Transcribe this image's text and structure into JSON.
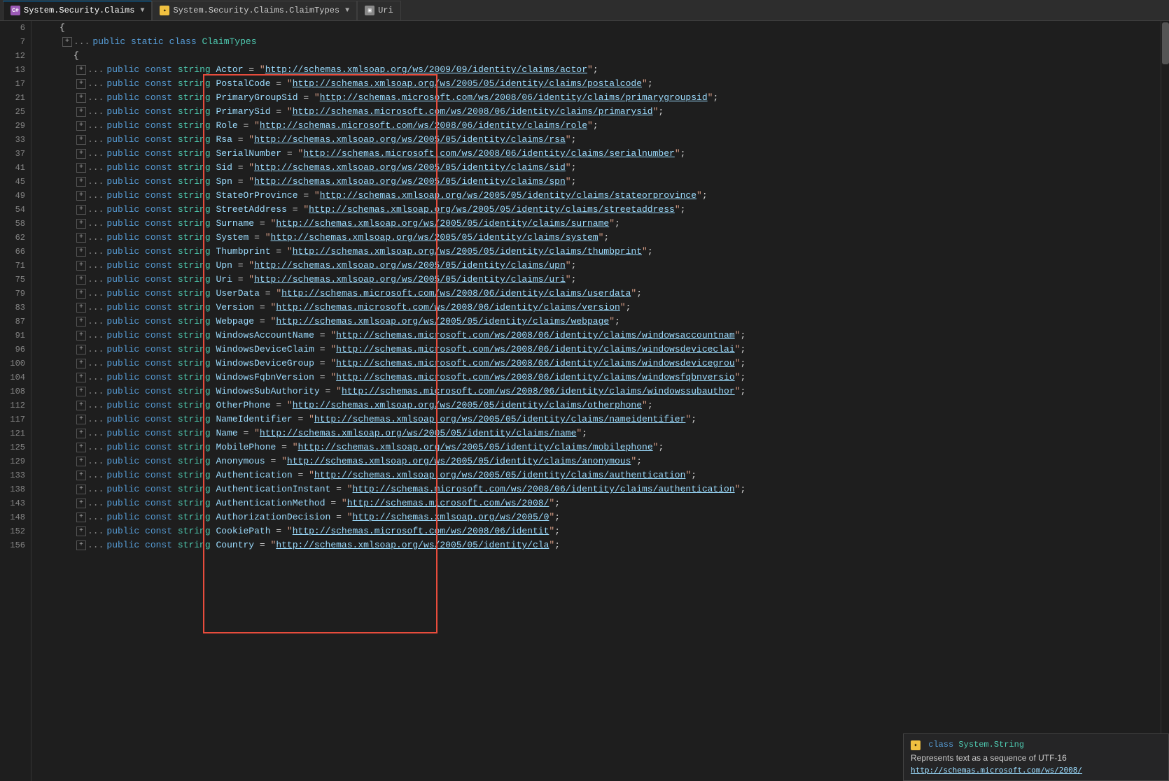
{
  "tabs": [
    {
      "id": "system-security-claims",
      "label": "System.Security.Claims",
      "icon": "cs",
      "active": true,
      "dropdown": true
    },
    {
      "id": "claim-types",
      "label": "System.Security.Claims.ClaimTypes",
      "icon": "cs-yellow",
      "active": false,
      "dropdown": true
    },
    {
      "id": "uri",
      "label": "Uri",
      "icon": "box",
      "active": false,
      "dropdown": false
    }
  ],
  "lines": [
    {
      "num": 6,
      "indent": 1,
      "content": "{"
    },
    {
      "num": 7,
      "indent": 2,
      "content": "public static class ClaimTypes",
      "has_expander": true,
      "has_dots": true
    },
    {
      "num": 12,
      "indent": 2,
      "content": "{",
      "has_expander": false
    },
    {
      "num": 13,
      "indent": 3,
      "content_parts": [
        "public const str",
        "ing Actor = \"",
        "http://schemas.xmlsoap.org/ws/2009/09/identity/claims/actor",
        "\";"
      ],
      "has_expander": true,
      "has_dots": true
    },
    {
      "num": 17,
      "indent": 3,
      "content_parts": [
        "public const str",
        "ing PostalCode = \"",
        "http://schemas.xmlsoap.org/ws/2005/05/identity/claims/postalcode",
        "\";"
      ],
      "has_expander": true,
      "has_dots": true
    },
    {
      "num": 21,
      "indent": 3,
      "content_parts": [
        "public const str",
        "ing PrimaryGroupSid = \"",
        "http://schemas.microsoft.com/ws/2008/06/identity/claims/primarygroupsid",
        "\";"
      ],
      "has_expander": true,
      "has_dots": true
    },
    {
      "num": 25,
      "indent": 3,
      "content_parts": [
        "public const str",
        "ing PrimarySid = \"",
        "http://schemas.microsoft.com/ws/2008/06/identity/claims/primarysid",
        "\";"
      ],
      "has_expander": true,
      "has_dots": true
    },
    {
      "num": 29,
      "indent": 3,
      "content_parts": [
        "public const str",
        "ing Role = \"",
        "http://schemas.microsoft.com/ws/2008/06/identity/claims/role",
        "\";"
      ],
      "has_expander": true,
      "has_dots": true
    },
    {
      "num": 33,
      "indent": 3,
      "content_parts": [
        "public const str",
        "ing Rsa = \"",
        "http://schemas.xmlsoap.org/ws/2005/05/identity/claims/rsa",
        "\";"
      ],
      "has_expander": true,
      "has_dots": true
    },
    {
      "num": 37,
      "indent": 3,
      "content_parts": [
        "public const str",
        "ing SerialNumber = \"",
        "http://schemas.microsoft.com/ws/2008/06/identity/claims/serialnumber",
        "\";"
      ],
      "has_expander": true,
      "has_dots": true
    },
    {
      "num": 41,
      "indent": 3,
      "content_parts": [
        "public const str",
        "ing Sid = \"",
        "http://schemas.xmlsoap.org/ws/2005/05/identity/claims/sid",
        "\";"
      ],
      "has_expander": true,
      "has_dots": true
    },
    {
      "num": 45,
      "indent": 3,
      "content_parts": [
        "public const str",
        "ing Spn = \"",
        "http://schemas.xmlsoap.org/ws/2005/05/identity/claims/spn",
        "\";"
      ],
      "has_expander": true,
      "has_dots": true
    },
    {
      "num": 49,
      "indent": 3,
      "content_parts": [
        "public const str",
        "ing StateOrProvince = \"",
        "http://schemas.xmlsoap.org/ws/2005/05/identity/claims/stateorprovince",
        "\";"
      ],
      "has_expander": true,
      "has_dots": true
    },
    {
      "num": 54,
      "indent": 3,
      "content_parts": [
        "public const str",
        "ing StreetAddress = \"",
        "http://schemas.xmlsoap.org/ws/2005/05/identity/claims/streetaddress",
        "\";"
      ],
      "has_expander": true,
      "has_dots": true
    },
    {
      "num": 58,
      "indent": 3,
      "content_parts": [
        "public const str",
        "ing Surname = \"",
        "http://schemas.xmlsoap.org/ws/2005/05/identity/claims/surname",
        "\";"
      ],
      "has_expander": true,
      "has_dots": true
    },
    {
      "num": 62,
      "indent": 3,
      "content_parts": [
        "public const str",
        "ing System = \"",
        "http://schemas.xmlsoap.org/ws/2005/05/identity/claims/system",
        "\";"
      ],
      "has_expander": true,
      "has_dots": true
    },
    {
      "num": 66,
      "indent": 3,
      "content_parts": [
        "public const str",
        "ing Thumbprint = \"",
        "http://schemas.xmlsoap.org/ws/2005/05/identity/claims/thumbprint",
        "\";"
      ],
      "has_expander": true,
      "has_dots": true
    },
    {
      "num": 71,
      "indent": 3,
      "content_parts": [
        "public const str",
        "ing Upn = \"",
        "http://schemas.xmlsoap.org/ws/2005/05/identity/claims/upn",
        "\";"
      ],
      "has_expander": true,
      "has_dots": true
    },
    {
      "num": 75,
      "indent": 3,
      "content_parts": [
        "public const str",
        "ing Uri = \"",
        "http://schemas.xmlsoap.org/ws/2005/05/identity/claims/uri",
        "\";"
      ],
      "has_expander": true,
      "has_dots": true
    },
    {
      "num": 79,
      "indent": 3,
      "content_parts": [
        "public const str",
        "ing UserData = \"",
        "http://schemas.microsoft.com/ws/2008/06/identity/claims/userdata",
        "\";"
      ],
      "has_expander": true,
      "has_dots": true
    },
    {
      "num": 83,
      "indent": 3,
      "content_parts": [
        "public const str",
        "ing Version = \"",
        "http://schemas.microsoft.com/ws/2008/06/identity/claims/version",
        "\";"
      ],
      "has_expander": true,
      "has_dots": true
    },
    {
      "num": 87,
      "indent": 3,
      "content_parts": [
        "public const str",
        "ing Webpage = \"",
        "http://schemas.xmlsoap.org/ws/2005/05/identity/claims/webpage",
        "\";"
      ],
      "has_expander": true,
      "has_dots": true
    },
    {
      "num": 91,
      "indent": 3,
      "content_parts": [
        "public const str",
        "ing WindowsAccountName = \"",
        "http://schemas.microsoft.com/ws/2008/06/identity/claims/windowsaccountnam",
        "\";"
      ],
      "has_expander": true,
      "has_dots": true
    },
    {
      "num": 96,
      "indent": 3,
      "content_parts": [
        "public const str",
        "ing WindowsDeviceClaim = \"",
        "http://schemas.microsoft.com/ws/2008/06/identity/claims/windowsdeviceclai",
        "\";"
      ],
      "has_expander": true,
      "has_dots": true
    },
    {
      "num": 100,
      "indent": 3,
      "content_parts": [
        "public const str",
        "ing WindowsDeviceGroup = \"",
        "http://schemas.microsoft.com/ws/2008/06/identity/claims/windowsdevicegrou",
        "\";"
      ],
      "has_expander": true,
      "has_dots": true
    },
    {
      "num": 104,
      "indent": 3,
      "content_parts": [
        "public const str",
        "ing WindowsFqbnVersion = \"",
        "http://schemas.microsoft.com/ws/2008/06/identity/claims/windowsfqbnversio",
        "\";"
      ],
      "has_expander": true,
      "has_dots": true
    },
    {
      "num": 108,
      "indent": 3,
      "content_parts": [
        "public const str",
        "ing WindowsSubAuthority = \"",
        "http://schemas.microsoft.com/ws/2008/06/identity/claims/windowssubauthor",
        "\";"
      ],
      "has_expander": true,
      "has_dots": true
    },
    {
      "num": 112,
      "indent": 3,
      "content_parts": [
        "public const str",
        "ing OtherPhone = \"",
        "http://schemas.xmlsoap.org/ws/2005/05/identity/claims/otherphone",
        "\";"
      ],
      "has_expander": true,
      "has_dots": true
    },
    {
      "num": 117,
      "indent": 3,
      "content_parts": [
        "public const str",
        "ing NameIdentifier = \"",
        "http://schemas.xmlsoap.org/ws/2005/05/identity/claims/nameidentifier",
        "\";"
      ],
      "has_expander": true,
      "has_dots": true
    },
    {
      "num": 121,
      "indent": 3,
      "content_parts": [
        "public const str",
        "ing Name = \"",
        "http://schemas.xmlsoap.org/ws/2005/05/identity/claims/name",
        "\";"
      ],
      "has_expander": true,
      "has_dots": true
    },
    {
      "num": 125,
      "indent": 3,
      "content_parts": [
        "public const str",
        "ing MobilePhone = \"",
        "http://schemas.xmlsoap.org/ws/2005/05/identity/claims/mobilephone",
        "\";"
      ],
      "has_expander": true,
      "has_dots": true
    },
    {
      "num": 129,
      "indent": 3,
      "content_parts": [
        "public const str",
        "ing Anonymous = \"",
        "http://schemas.xmlsoap.org/ws/2005/05/identity/claims/anonymous",
        "\";"
      ],
      "has_expander": true,
      "has_dots": true
    },
    {
      "num": 133,
      "indent": 3,
      "content_parts": [
        "public const str",
        "ing Authentication = \"",
        "http://schemas.xmlsoap.org/ws/2005/05/identity/claims/authentication",
        "\";"
      ],
      "has_expander": true,
      "has_dots": true
    },
    {
      "num": 138,
      "indent": 3,
      "content_parts": [
        "public const str",
        "ing AuthenticationInstant = \"",
        "http://schemas.microsoft.com/ws/2008/06/identity/claims/authentication",
        "\";"
      ],
      "has_expander": true,
      "has_dots": true
    },
    {
      "num": 143,
      "indent": 3,
      "content_parts": [
        "public const str",
        "ing AuthenticationMethod = \"",
        "http://schemas.microsoft.com/ws/2008/",
        "...\""
      ],
      "has_expander": true,
      "has_dots": true
    },
    {
      "num": 148,
      "indent": 3,
      "content_parts": [
        "public const str",
        "ing AuthorizationDecision = \"",
        "http://schemas.xmlsoap.org/ws/2005/0",
        "...\""
      ],
      "has_expander": true,
      "has_dots": true
    },
    {
      "num": 152,
      "indent": 3,
      "content_parts": [
        "public const str",
        "ing CookiePath = \"",
        "http://schemas.microsoft.com/ws/2008/06/identit",
        "...\""
      ],
      "has_expander": true,
      "has_dots": true
    },
    {
      "num": 156,
      "indent": 3,
      "content_parts": [
        "public const str",
        "ing Country = \"",
        "http://schemas.xmlsoap.org/ws/2005/05/identity/cla",
        "...\""
      ],
      "has_expander": true,
      "has_dots": true
    }
  ],
  "tooltip": {
    "type_label": "class",
    "class_name": "System.String",
    "description": "Represents text as a sequence of UTF-16",
    "url": "http://schemas.microsoft.com/ws/2008/"
  },
  "title": "System Security Claims"
}
